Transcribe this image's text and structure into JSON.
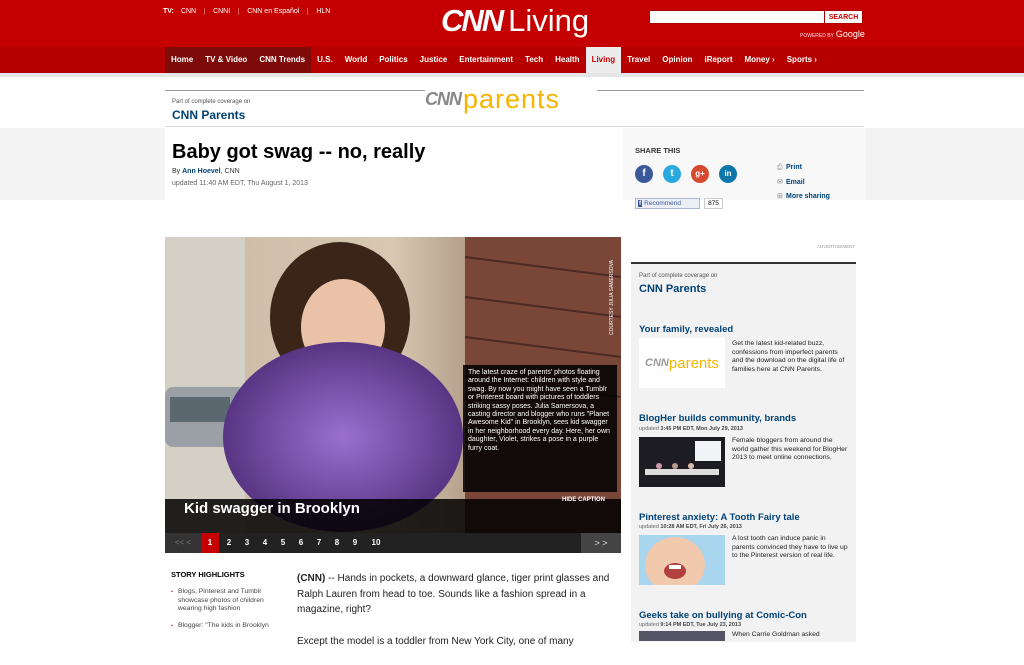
{
  "header": {
    "tv_label": "TV:",
    "tv_links": [
      "CNN",
      "CNNI",
      "CNN en Español",
      "HLN"
    ],
    "logo_cnn": "CNN",
    "logo_section": "Living",
    "search_button": "SEARCH",
    "powered_by": "POWERED BY",
    "google": "Google"
  },
  "nav": [
    "Home",
    "TV & Video",
    "CNN Trends",
    "U.S.",
    "World",
    "Politics",
    "Justice",
    "Entertainment",
    "Tech",
    "Health",
    "Living",
    "Travel",
    "Opinion",
    "iReport",
    "Money ›",
    "Sports ›"
  ],
  "coverage": {
    "label": "Part of complete coverage on",
    "title": "CNN Parents",
    "logo_cnn": "CNN",
    "logo_text": "parents"
  },
  "article": {
    "title": "Baby got swag -- no, really",
    "by": "By ",
    "author": "Ann Hoevel",
    "source": ", CNN",
    "updated": "updated 11:40 AM EDT, Thu August 1, 2013"
  },
  "share": {
    "title": "SHARE THIS",
    "recommend_label": "Recommend",
    "recommend_count": "875",
    "links": [
      "Print",
      "Email",
      "More sharing"
    ]
  },
  "gallery": {
    "caption": "The latest craze of parents' photos floating around the Internet: children with style and swag. By now you might have seen a Tumblr or Pinterest board with pictures of toddlers striking sassy poses. Julia Samersova, a casting director and blogger who runs \"Planet Awesome Kid\" in Brooklyn, sees kid swagger in her neighborhood every day. Here, her own daughter, Violet, strikes a pose in a purple furry coat.",
    "credit": "COURTESY JULIA SAMERSOVA",
    "hide_caption": "HIDE CAPTION",
    "title": "Kid swagger in Brooklyn",
    "prev": "<<  <",
    "next": ">  >",
    "pages": [
      "1",
      "2",
      "3",
      "4",
      "5",
      "6",
      "7",
      "8",
      "9",
      "10"
    ],
    "current_page": "1"
  },
  "highlights": {
    "title": "STORY HIGHLIGHTS",
    "items": [
      "Blogs, Pinterest and Tumblr showcase photos of children wearing high fashion",
      "Blogger: \"The kids in Brooklyn"
    ]
  },
  "body": {
    "p1_lead": "(CNN)",
    "p1": " -- Hands in pockets, a downward glance, tiger print glasses and Ralph Lauren from head to toe. Sounds like a fashion spread in a magazine, right?",
    "p2": "Except the model is a toddler from New York City, one of many"
  },
  "rail": {
    "advertisement": "ADVERTISEMENT",
    "label": "Part of complete coverage on",
    "title": "CNN Parents",
    "items": [
      {
        "head": "Your family, revealed",
        "date": "",
        "thumb_cnn": "CNN",
        "thumb_text": "parents",
        "text": "Get the latest kid-related buzz, confessions from imperfect parents and the download on the digital life of families here at CNN Parents."
      },
      {
        "head": "BlogHer builds community, brands",
        "date_label": "updated",
        "date": "3:45 PM EDT, Mon July 29, 2013",
        "text": "Female bloggers from around the world gather this weekend for BlogHer 2013 to meet online connections."
      },
      {
        "head": "Pinterest anxiety: A Tooth Fairy tale",
        "date_label": "updated",
        "date": "10:28 AM EDT, Fri July 26, 2013",
        "text": "A lost tooth can induce panic in parents convinced they have to live up to the Pinterest version of real life."
      },
      {
        "head": "Geeks take on bullying at Comic-Con",
        "date_label": "updated",
        "date": "9:14 PM EDT, Tue July 23, 2013",
        "text": "When Carrie Goldman asked"
      }
    ]
  },
  "colors": {
    "cnn_red": "#c40000",
    "nav_red": "#b60000",
    "link_blue": "#004276",
    "parents_yellow": "#f5b400"
  }
}
